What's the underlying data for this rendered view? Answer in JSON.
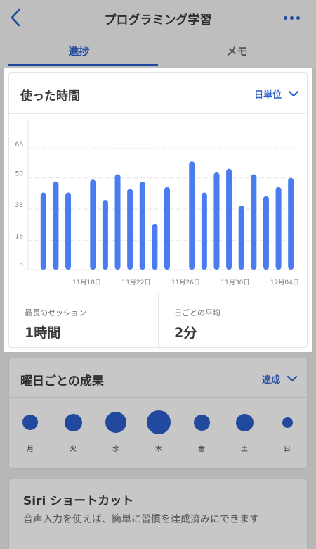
{
  "nav": {
    "title": "プログラミング学習",
    "back_icon": "chevron-left-icon",
    "more_icon": "more-horizontal-icon"
  },
  "tabs": [
    {
      "label": "進捗",
      "active": true
    },
    {
      "label": "メモ",
      "active": false
    }
  ],
  "time_card": {
    "title": "使った時間",
    "period_label": "日単位",
    "chart_data": {
      "type": "bar",
      "title": "",
      "xlabel": "",
      "ylabel": "",
      "ylim": [
        0,
        66
      ],
      "yticks": [
        0,
        16,
        33,
        50,
        66
      ],
      "grid": true,
      "x_tick_labels": [
        {
          "label": "11月18日",
          "index": 4
        },
        {
          "label": "11月22日",
          "index": 8
        },
        {
          "label": "11月26日",
          "index": 12
        },
        {
          "label": "11月30日",
          "index": 16
        },
        {
          "label": "12月04日",
          "index": 20
        }
      ],
      "values": [
        42,
        48,
        42,
        null,
        49,
        38,
        52,
        44,
        48,
        25,
        45,
        null,
        59,
        42,
        53,
        55,
        35,
        52,
        40,
        45,
        50
      ],
      "color": "#4a7cf0"
    },
    "stats": {
      "longest_label": "最長のセッション",
      "longest_value": "1時間",
      "average_label": "日ごとの平均",
      "average_value": "2分"
    }
  },
  "weekday_card": {
    "title": "曜日ごとの成果",
    "metric_label": "達成",
    "days": [
      {
        "label": "月",
        "level": 0.55
      },
      {
        "label": "火",
        "level": 0.65
      },
      {
        "label": "水",
        "level": 0.85
      },
      {
        "label": "木",
        "level": 1.0
      },
      {
        "label": "金",
        "level": 0.58
      },
      {
        "label": "土",
        "level": 0.65
      },
      {
        "label": "日",
        "level": 0.28
      }
    ],
    "color": "#2b5fcc"
  },
  "siri_card": {
    "title": "Siri ショートカット",
    "description": "音声入力を使えば、簡単に習慣を達成済みにできます"
  },
  "colors": {
    "accent": "#2b5fcc",
    "bar": "#4a7cf0"
  }
}
